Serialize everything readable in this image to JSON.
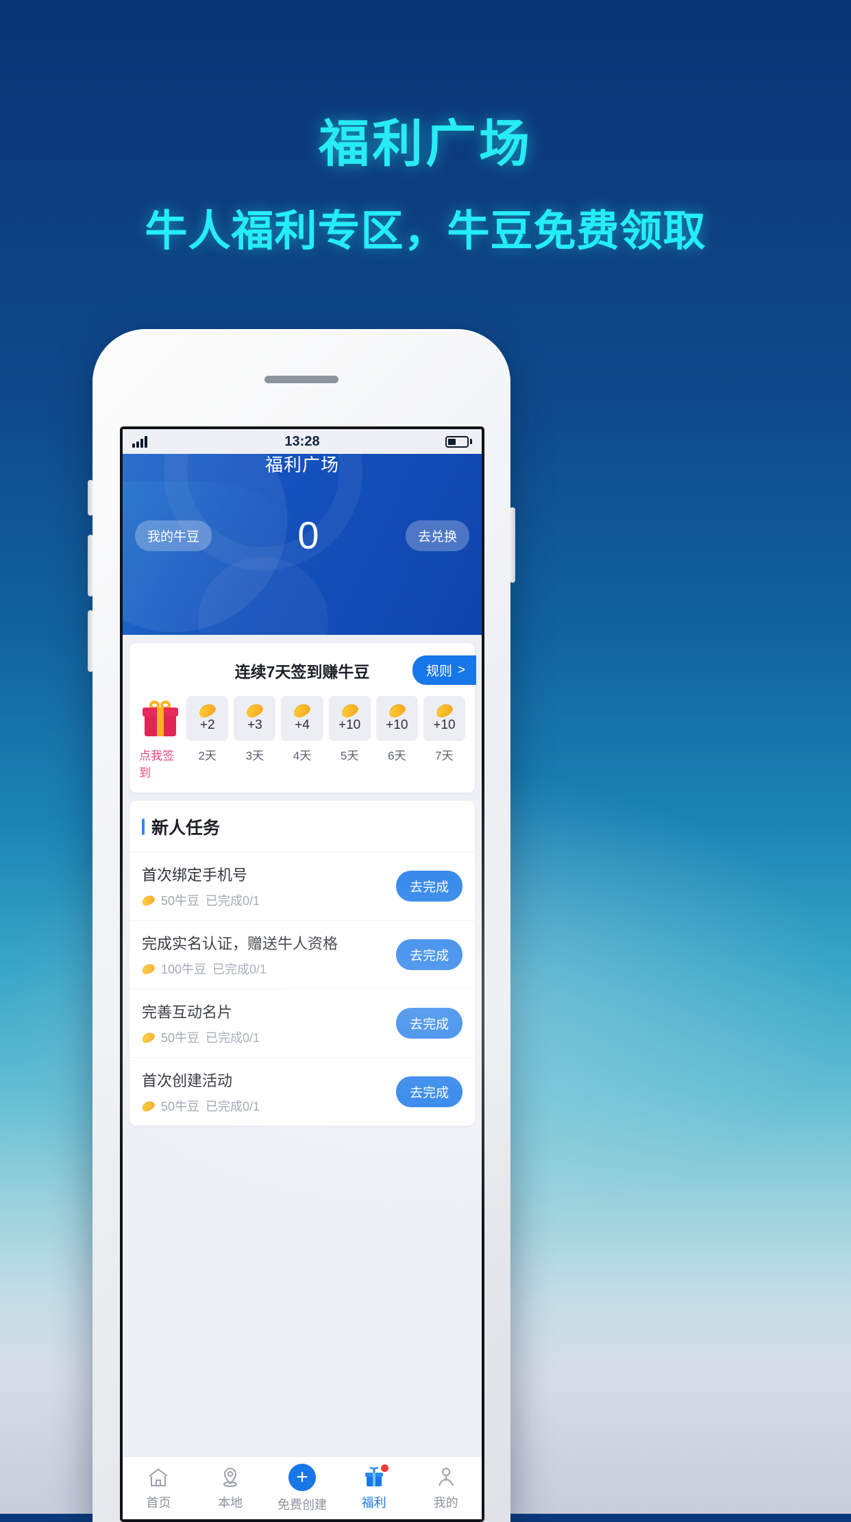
{
  "poster": {
    "title": "福利广场",
    "subtitle": "牛人福利专区，牛豆免费领取",
    "title_color": "#28ecf5"
  },
  "status_bar": {
    "time": "13:28",
    "signal_icon": "signal-bars-icon",
    "battery_icon": "battery-icon",
    "battery_level": "42%"
  },
  "app_header": {
    "title": "福利广场",
    "my_beans_label": "我的牛豆",
    "balance": "0",
    "exchange_label": "去兑换",
    "accent": "#1452bd"
  },
  "signin": {
    "title": "连续7天签到赚牛豆",
    "rule_label": "规则",
    "rule_chevron": ">",
    "checkin_label": "点我签到",
    "gift_icon": "gift-box-icon",
    "days": [
      {
        "reward": "+2",
        "label": "2天"
      },
      {
        "reward": "+3",
        "label": "3天"
      },
      {
        "reward": "+4",
        "label": "4天"
      },
      {
        "reward": "+10",
        "label": "5天"
      },
      {
        "reward": "+10",
        "label": "6天"
      },
      {
        "reward": "+10",
        "label": "7天"
      }
    ]
  },
  "tasks": {
    "section_title": "新人任务",
    "items": [
      {
        "name": "首次绑定手机号",
        "reward": "50牛豆",
        "progress": "已完成0/1",
        "action": "去完成"
      },
      {
        "name": "完成实名认证，赠送牛人资格",
        "reward": "100牛豆",
        "progress": "已完成0/1",
        "action": "去完成"
      },
      {
        "name": "完善互动名片",
        "reward": "50牛豆",
        "progress": "已完成0/1",
        "action": "去完成"
      },
      {
        "name": "首次创建活动",
        "reward": "50牛豆",
        "progress": "已完成0/1",
        "action": "去完成"
      }
    ]
  },
  "tabbar": {
    "items": [
      {
        "label": "首页",
        "icon": "home-icon",
        "active": false
      },
      {
        "label": "本地",
        "icon": "location-pin-icon",
        "active": false
      },
      {
        "label": "免费创建",
        "icon": "plus-circle-icon",
        "active": false
      },
      {
        "label": "福利",
        "icon": "gift-welfare-icon",
        "active": true,
        "badge": true
      },
      {
        "label": "我的",
        "icon": "person-icon",
        "active": false
      }
    ]
  }
}
